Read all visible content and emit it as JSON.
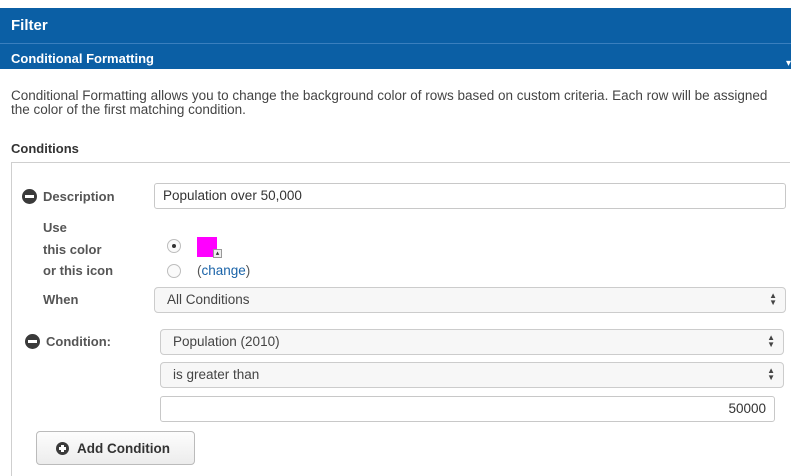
{
  "header": {
    "title": "Filter",
    "subtitle": "Conditional Formatting",
    "caret_icon": "caret-down-icon"
  },
  "intro_text": "Conditional Formatting allows you to change the background color of rows based on custom criteria. Each row will be assigned the color of the first matching condition.",
  "section_title": "Conditions",
  "rule": {
    "description_label": "Description",
    "description_value": "Population over 50,000",
    "use_label": "Use",
    "color_label": "this color",
    "icon_label": "or this icon",
    "selected_option": "color",
    "swatch_color": "#ff00ff",
    "icon_link_open": "(",
    "icon_link_text": "change",
    "icon_link_close": ")",
    "when_label": "When",
    "when_value": "All Conditions"
  },
  "condition": {
    "label": "Condition:",
    "field_value": "Population (2010)",
    "operator_value": "is greater than",
    "value": "50000"
  },
  "add_condition_label": "Add Condition"
}
